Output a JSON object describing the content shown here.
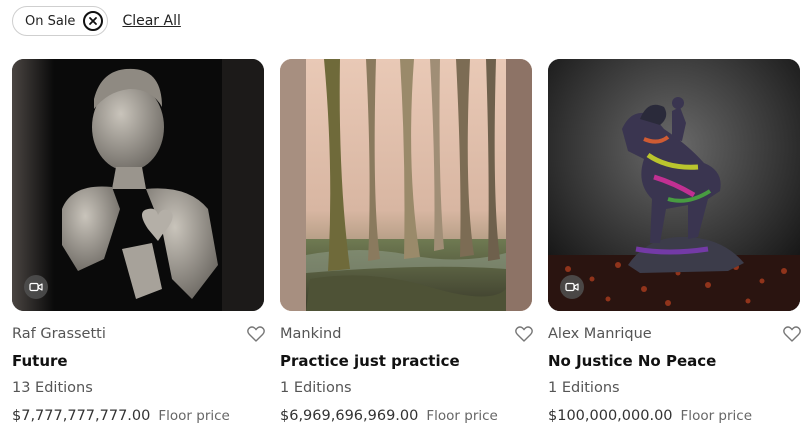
{
  "filters": {
    "chip_label": "On Sale",
    "clear_label": "Clear All"
  },
  "cards": [
    {
      "artist": "Raf Grassetti",
      "title": "Future",
      "editions": "13 Editions",
      "price": "$7,777,777,777.00",
      "floor_label": "Floor price",
      "media": "video",
      "image_desc": "broken-sculpture-bust"
    },
    {
      "artist": "Mankind",
      "title": "Practice just practice",
      "editions": "1 Editions",
      "price": "$6,969,696,969.00",
      "floor_label": "Floor price",
      "media": "image",
      "image_desc": "forest-swamp"
    },
    {
      "artist": "Alex Manrique",
      "title": "No Justice No Peace",
      "editions": "1 Editions",
      "price": "$100,000,000.00",
      "floor_label": "Floor price",
      "media": "video",
      "image_desc": "rearing-horse-statue"
    }
  ]
}
